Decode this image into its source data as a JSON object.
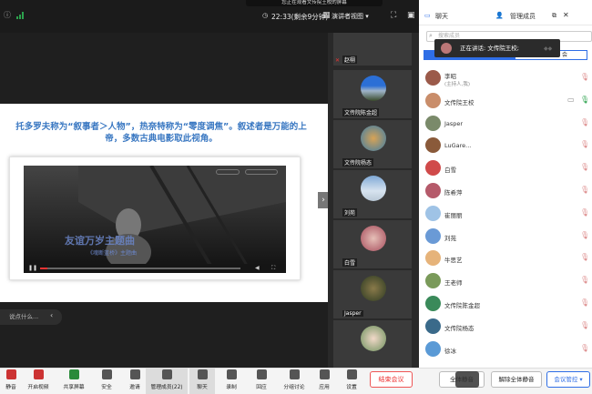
{
  "top": {
    "notice": "您正在观看文传院王校的屏幕",
    "timer": "22:33(剩余9分钟)",
    "view_label": "演讲者视图"
  },
  "slide": {
    "title": "托多罗夫称为“叙事者＞人物”，热奈特称为“零度调焦”。叙述者是万能的上帝，多数古典电影取此视角。"
  },
  "video": {
    "caption": "友谊万岁主题曲",
    "subtitle": "《魂断蓝桥》主题曲"
  },
  "chat_input": {
    "placeholder": "说点什么..."
  },
  "strip": [
    {
      "name": "赵栩"
    },
    {
      "name": "文传院陈金超"
    },
    {
      "name": "文传院杨态"
    },
    {
      "name": "刘苑"
    },
    {
      "name": "白雪"
    },
    {
      "name": "Jasper"
    },
    {
      "name": ""
    }
  ],
  "panel": {
    "tab_chat": "聊天",
    "tab_members": "管理成员",
    "search_placeholder": "搜索成员",
    "seg_right": "会",
    "speaking": "正在讲话: 文传院王校;",
    "members": [
      {
        "name": "李昭",
        "sub": "(主持人,我)"
      },
      {
        "name": "文传院王校",
        "sub": ""
      },
      {
        "name": "Jasper",
        "sub": ""
      },
      {
        "name": "LuGare...",
        "sub": ""
      },
      {
        "name": "白雪",
        "sub": ""
      },
      {
        "name": "陈希萍",
        "sub": ""
      },
      {
        "name": "崔丽丽",
        "sub": ""
      },
      {
        "name": "刘苑",
        "sub": ""
      },
      {
        "name": "牛思艺",
        "sub": ""
      },
      {
        "name": "王老师",
        "sub": ""
      },
      {
        "name": "文传院陈金超",
        "sub": ""
      },
      {
        "name": "文传院杨态",
        "sub": ""
      },
      {
        "name": "徐冰",
        "sub": ""
      }
    ]
  },
  "toolbar": {
    "items": [
      "静音",
      "开启视频",
      "共享屏幕",
      "安全",
      "邀请",
      "管理成员(22)",
      "聊天",
      "录制",
      "回应",
      "分组讨论",
      "应用",
      "设置"
    ],
    "end_meeting": "结束会议",
    "mute_all": "全体静音",
    "unmute_all": "解除全体静音",
    "meeting_control": "会议管控"
  },
  "colors": {
    "accent": "#2f6ee6",
    "slide_title": "#3a78c2",
    "end": "#e33333",
    "mic_on": "#2ca24d"
  }
}
